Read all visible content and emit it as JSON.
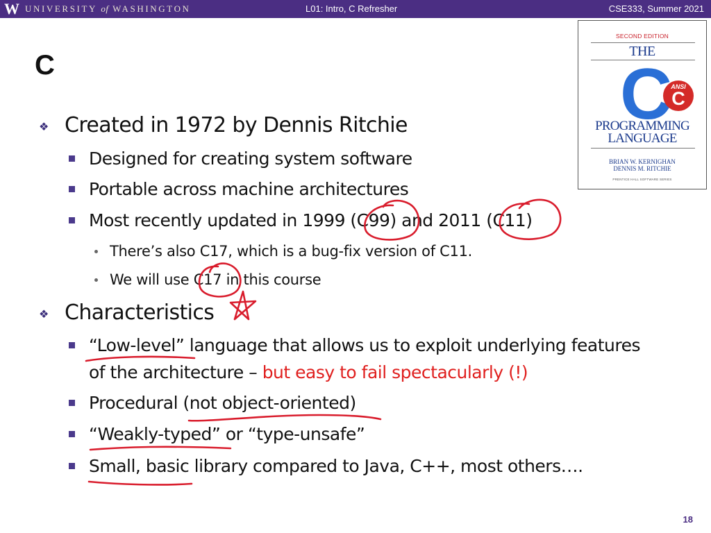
{
  "header": {
    "logo_letter": "W",
    "university_pre": "UNIVERSITY",
    "university_of": "of",
    "university_post": "WASHINGTON",
    "lecture": "L01:  Intro, C Refresher",
    "course": "CSE333, Summer 2021"
  },
  "slide": {
    "title": "C",
    "page_number": "18"
  },
  "book": {
    "edition": "SECOND EDITION",
    "the": "THE",
    "big_letter": "C",
    "ansi_label": "ANSI",
    "ansi_letter": "C",
    "title_line1": "PROGRAMMING",
    "title_line2": "LANGUAGE",
    "author1": "BRIAN W. KERNIGHAN",
    "author2": "DENNIS M. RITCHIE",
    "publisher": "PRENTICE HALL SOFTWARE SERIES"
  },
  "bullets": {
    "created": "Created in 1972 by Dennis Ritchie",
    "designed": "Designed for creating system software",
    "portable": "Portable across machine architectures",
    "updated": "Most recently updated in 1999 (C99) and 2011 (C11)",
    "c17_fix": "There’s also C17, which is a bug-fix version of C11.",
    "c17_use": "We will use C17 in this course",
    "characteristics": "Characteristics",
    "lowlevel_a": "“Low-level” language that allows us to exploit underlying features",
    "lowlevel_b": "of the architecture – ",
    "lowlevel_red": "but easy to fail spectacularly (!)",
    "procedural": "Procedural (not object-oriented)",
    "weakly": "“Weakly-typed” or “type-unsafe”",
    "small": "Small, basic library compared to Java, C++, most others…."
  },
  "colors": {
    "header_bg": "#4b2e83",
    "accent_red": "#e0201f",
    "ink_red": "#d91c2c",
    "cover_blue": "#2a6fd6"
  }
}
